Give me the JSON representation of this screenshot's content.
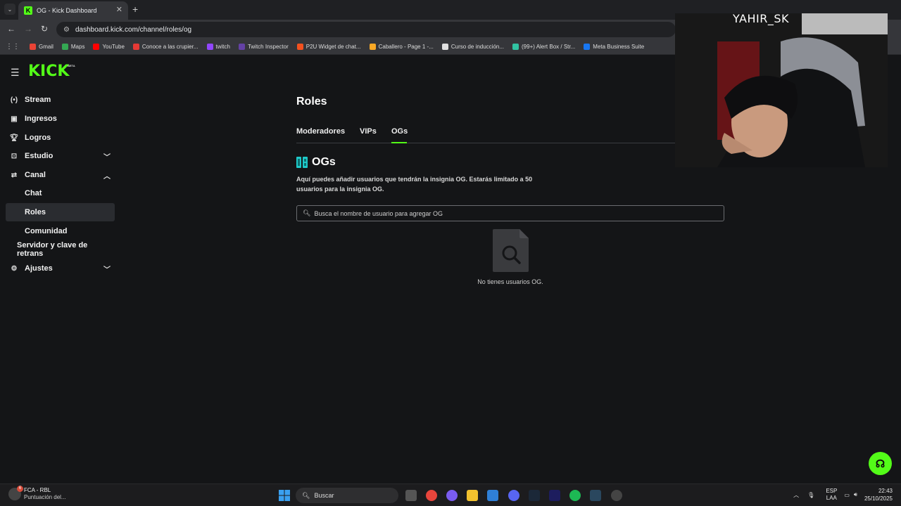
{
  "browser": {
    "tab_title": "OG - Kick Dashboard",
    "url": "dashboard.kick.com/channel/roles/og",
    "bookmarks": [
      {
        "label": "Gmail",
        "color": "#ea4335"
      },
      {
        "label": "Maps",
        "color": "#34a853"
      },
      {
        "label": "YouTube",
        "color": "#ff0000"
      },
      {
        "label": "Conoce a las crupier...",
        "color": "#e53935"
      },
      {
        "label": "twitch",
        "color": "#9146ff"
      },
      {
        "label": "Twitch Inspector",
        "color": "#6441a5"
      },
      {
        "label": "P2U Widget de chat...",
        "color": "#f4511e"
      },
      {
        "label": "Caballero - Page 1 -...",
        "color": "#f9a825"
      },
      {
        "label": "Curso de inducción...",
        "color": "#e0e0e0"
      },
      {
        "label": "(99+) Alert Box / Str...",
        "color": "#31c3a2"
      },
      {
        "label": "Meta Business Suite",
        "color": "#1877f2"
      }
    ]
  },
  "app": {
    "logo": "KICK",
    "beta": "BETA"
  },
  "sidebar": {
    "items": [
      {
        "label": "Stream",
        "icon": "broadcast-icon"
      },
      {
        "label": "Ingresos",
        "icon": "chart-icon"
      },
      {
        "label": "Logros",
        "icon": "trophy-icon"
      },
      {
        "label": "Estudio",
        "icon": "studio-icon"
      },
      {
        "label": "Canal",
        "icon": "channel-icon"
      }
    ],
    "sub_items": [
      {
        "label": "Chat"
      },
      {
        "label": "Roles"
      },
      {
        "label": "Comunidad"
      }
    ],
    "stream_key": "Servidor y clave de retrans",
    "settings": "Ajustes"
  },
  "main": {
    "title": "Roles",
    "tabs": [
      "Moderadores",
      "VIPs",
      "OGs"
    ],
    "active_tab": "OGs",
    "section_title": "OGs",
    "description": "Aquí puedes añadir usuarios que tendrán la insignia OG. Estarás limitado a 50 usuarios para la insignia OG.",
    "search_placeholder": "Busca el nombre de usuario para agregar OG",
    "empty_text": "No tienes usuarios OG."
  },
  "webcam": {
    "name": "YAHIR_SK"
  },
  "taskbar": {
    "weather_title": "FCA - RBL",
    "weather_sub": "Puntuación del...",
    "search_label": "Buscar",
    "lang_top": "ESP",
    "lang_bottom": "LAA",
    "time": "22:43",
    "date": "25/10/2025",
    "notification_count": "6"
  },
  "colors": {
    "accent": "#53fc18",
    "background": "#141517",
    "sidebar_active": "#2a2c30"
  }
}
